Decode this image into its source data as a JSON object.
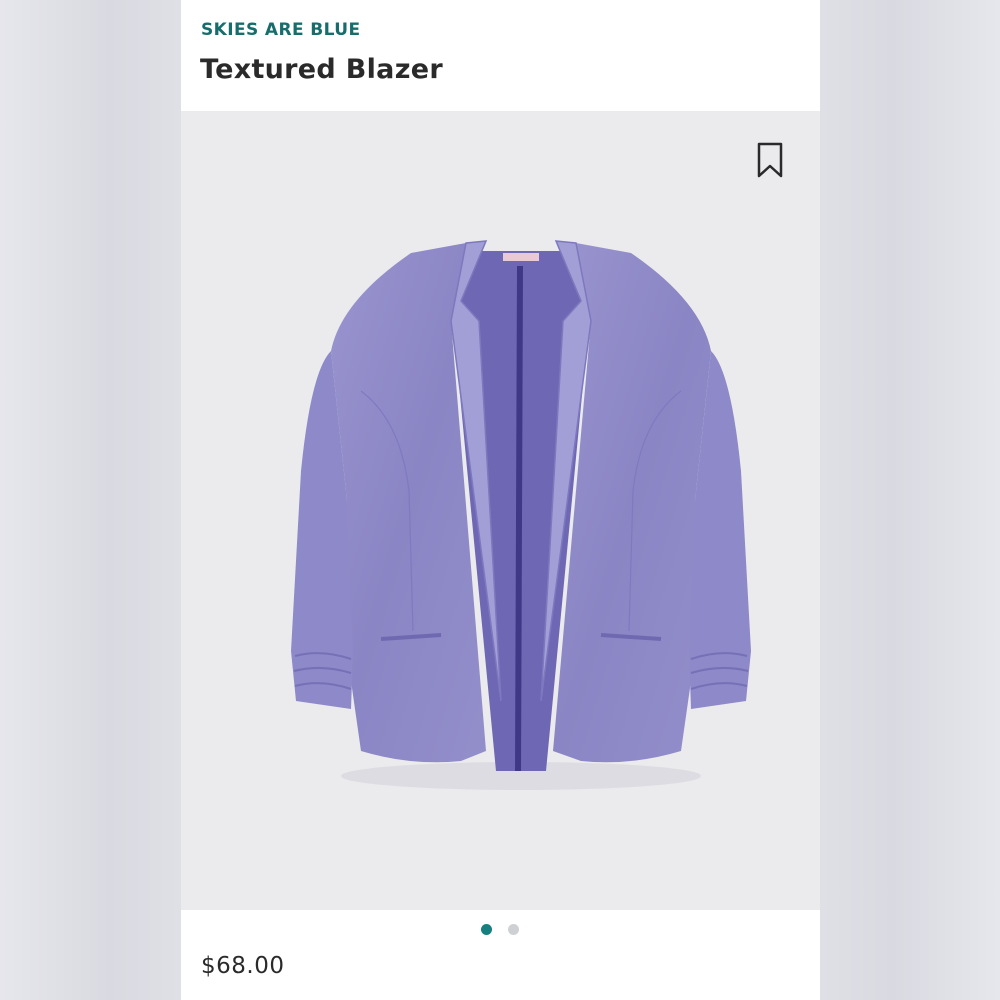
{
  "product": {
    "brand": "SKIES ARE BLUE",
    "title": "Textured Blazer",
    "price": "$68.00"
  },
  "gallery": {
    "image_alt": "purple textured blazer",
    "current_index": 1,
    "total": 2
  },
  "icons": {
    "save": "bookmark-icon"
  },
  "colors": {
    "brand_teal": "#166d6c",
    "dot_active": "#16807e",
    "dot_inactive": "#cfd0d3",
    "blazer": "#8c87c6"
  }
}
